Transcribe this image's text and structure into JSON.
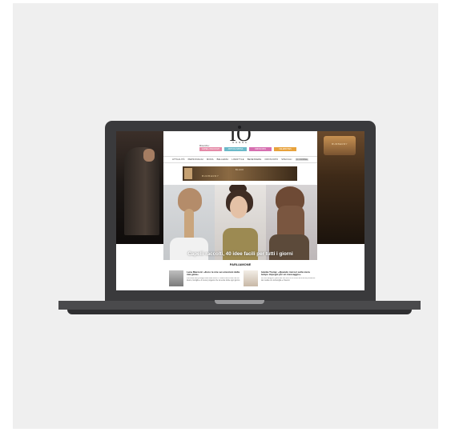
{
  "site": {
    "logo": "IO",
    "logo_sub": "DONNA",
    "search_label": "Ricerche:",
    "tags": [
      {
        "label": "CAPELLI RACCOLTI",
        "color": "#e58aa7"
      },
      {
        "label": "ABITI DA SPOSA",
        "color": "#6ab9c9"
      },
      {
        "label": "OROSCOPO",
        "color": "#d66fb0"
      },
      {
        "label": "CELEBRITIES",
        "color": "#e8a23c"
      }
    ],
    "nav": [
      "ATTUALITÀ",
      "PERSONAGGI",
      "MODA",
      "BELLEZZA",
      "LIFESTYLE",
      "BENESSERE",
      "OROSCOPO",
      "SPECIALI",
      "IO DONNA"
    ],
    "nav_active": "IO DONNA",
    "ad": {
      "brand": "BURBERRY",
      "text": "BLACK"
    },
    "hero_title": "Capelli raccolti, 40 idee facili per tutti i giorni",
    "side_brand": "BURBERRY",
    "section_title": "PARLIAMONE",
    "news": [
      {
        "headline": "Lena Mazzoni: «Ecco le mie sei emozioni della mia gioia»",
        "excerpt": "Intervista alla protagonista della serie tv. Racconta la sua vita tra lavoro, famiglia e il nuovo progetto che la rende felice ogni giorno"
      },
      {
        "headline": "Ivanka Trump: «Quando incroci sulla via la tempo impegni per un messaggio»",
        "excerpt": "La first daughter parla del suo libro e di come affronta la pressione dei media con la famiglia e il lavoro"
      }
    ]
  },
  "colors": {
    "laptop_body": "#3a3a3c",
    "background_card": "#efefef"
  }
}
